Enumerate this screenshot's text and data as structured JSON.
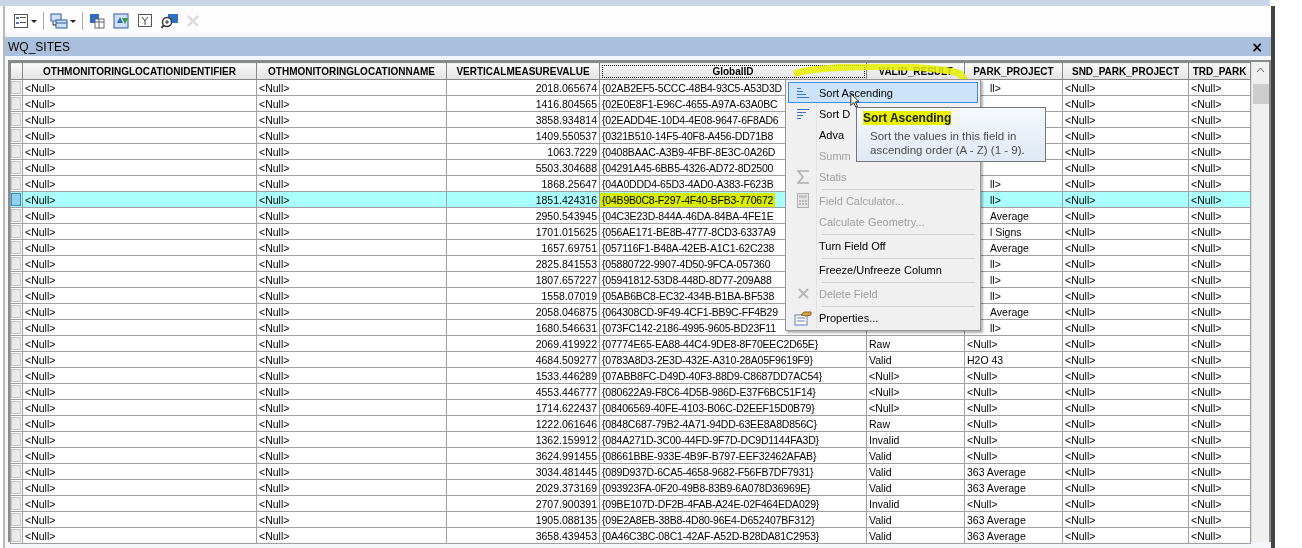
{
  "panel": {
    "title": "WQ_SITES",
    "close": "×"
  },
  "toolbar": [
    {
      "kind": "table-options",
      "dropdown": true,
      "disabled": false
    },
    {
      "kind": "related-tables",
      "dropdown": true,
      "disabled": false
    },
    {
      "kind": "select-attributes",
      "dropdown": false,
      "disabled": false
    },
    {
      "kind": "switch-selection",
      "dropdown": false,
      "disabled": false
    },
    {
      "kind": "clear-selection",
      "dropdown": false,
      "disabled": false
    },
    {
      "kind": "zoom-selected",
      "dropdown": false,
      "disabled": false
    },
    {
      "kind": "delete",
      "dropdown": false,
      "disabled": true
    }
  ],
  "table": {
    "columns": [
      {
        "label": "OTHMONITORINGLOCATIONIDENTIFIER",
        "selected": false
      },
      {
        "label": "OTHMONITORINGLOCATIONNAME",
        "selected": false
      },
      {
        "label": "VERTICALMEASUREVALUE",
        "selected": false
      },
      {
        "label": "GlobalID",
        "selected": true
      },
      {
        "label": "VALID_RESULT",
        "selected": false
      },
      {
        "label": "PARK_PROJECT",
        "selected": false
      },
      {
        "label": "SND_PARK_PROJECT",
        "selected": false
      },
      {
        "label": "TRD_PARK",
        "selected": false
      }
    ],
    "rows": [
      {
        "cells": [
          "<Null>",
          "<Null>",
          "2018.065674",
          "{02AB2EF5-5CCC-48B4-93C5-A53D3D",
          null,
          "ll>",
          "<Null>",
          "<Null>"
        ],
        "selected": false,
        "marked": false
      },
      {
        "cells": [
          "<Null>",
          "<Null>",
          "1416.804565",
          "{02E0E8F1-E96C-4655-A97A-63A0BC",
          null,
          null,
          "<Null>",
          "<Null>"
        ],
        "selected": false,
        "marked": false
      },
      {
        "cells": [
          "<Null>",
          "<Null>",
          "3858.934814",
          "{02EADD4E-10D4-4E08-9647-6F8AD6",
          null,
          null,
          "<Null>",
          "<Null>"
        ],
        "selected": false,
        "marked": false
      },
      {
        "cells": [
          "<Null>",
          "<Null>",
          "1409.550537",
          "{0321B510-14F5-40F8-A456-DD71B8",
          null,
          null,
          "<Null>",
          "<Null>"
        ],
        "selected": false,
        "marked": false
      },
      {
        "cells": [
          "<Null>",
          "<Null>",
          "1063.7229",
          "{0408BAAC-A3B9-4FBF-8E3C-0A26D",
          null,
          null,
          "<Null>",
          "<Null>"
        ],
        "selected": false,
        "marked": false
      },
      {
        "cells": [
          "<Null>",
          "<Null>",
          "5503.304688",
          "{04291A45-6BB5-4326-AD72-8D2500",
          null,
          null,
          "<Null>",
          "<Null>"
        ],
        "selected": false,
        "marked": false
      },
      {
        "cells": [
          "<Null>",
          "<Null>",
          "1868.25647",
          "{04A0DDD4-65D3-4AD0-A383-F623B",
          null,
          "ll>",
          "<Null>",
          "<Null>"
        ],
        "selected": false,
        "marked": false
      },
      {
        "cells": [
          "<Null>",
          "<Null>",
          "1851.424316",
          "{04B9B0C8-F297-4F40-BFB3-770672",
          null,
          "ll>",
          "<Null>",
          "<Null>"
        ],
        "selected": true,
        "marked": true
      },
      {
        "cells": [
          "<Null>",
          "<Null>",
          "2950.543945",
          "{04C3E23D-844A-46DA-84BA-4FE1E",
          null,
          "Average",
          "<Null>",
          "<Null>"
        ],
        "selected": false,
        "marked": false
      },
      {
        "cells": [
          "<Null>",
          "<Null>",
          "1701.015625",
          "{056AE171-BE8B-4777-8CD3-6337A9",
          null,
          "l Signs",
          "<Null>",
          "<Null>"
        ],
        "selected": false,
        "marked": false
      },
      {
        "cells": [
          "<Null>",
          "<Null>",
          "1657.69751",
          "{057116F1-B48A-42EB-A1C1-62C238",
          null,
          "Average",
          "<Null>",
          "<Null>"
        ],
        "selected": false,
        "marked": false
      },
      {
        "cells": [
          "<Null>",
          "<Null>",
          "2825.841553",
          "{05880722-9907-4D50-9FCA-057360",
          null,
          "ll>",
          "<Null>",
          "<Null>"
        ],
        "selected": false,
        "marked": false
      },
      {
        "cells": [
          "<Null>",
          "<Null>",
          "1807.657227",
          "{05941812-53D8-448D-8D77-209A88",
          null,
          "ll>",
          "<Null>",
          "<Null>"
        ],
        "selected": false,
        "marked": false
      },
      {
        "cells": [
          "<Null>",
          "<Null>",
          "1558.07019",
          "{05AB6BC8-EC32-434B-B1BA-BF538",
          null,
          "ll>",
          "<Null>",
          "<Null>"
        ],
        "selected": false,
        "marked": false
      },
      {
        "cells": [
          "<Null>",
          "<Null>",
          "2058.046875",
          "{064308CD-9F49-4CF1-BB9C-FF4B29",
          null,
          "Average",
          "<Null>",
          "<Null>"
        ],
        "selected": false,
        "marked": false
      },
      {
        "cells": [
          "<Null>",
          "<Null>",
          "1680.546631",
          "{073FC142-2186-4995-9605-BD23F11",
          null,
          "ll>",
          "<Null>",
          "<Null>"
        ],
        "selected": false,
        "marked": false
      },
      {
        "cells": [
          "<Null>",
          "<Null>",
          "2069.419922",
          "{07774E65-EA88-44C4-9DE8-8F70EEC2D65E}",
          "Raw",
          "<Null>",
          "<Null>",
          "<Null>"
        ],
        "selected": false,
        "marked": false
      },
      {
        "cells": [
          "<Null>",
          "<Null>",
          "4684.509277",
          "{0783A8D3-2E3D-432E-A310-28A05F9619F9}",
          "Valid",
          "H2O 43",
          "<Null>",
          "<Null>"
        ],
        "selected": false,
        "marked": false
      },
      {
        "cells": [
          "<Null>",
          "<Null>",
          "1533.446289",
          "{07ABB8FC-D49D-40F3-88D9-C8687DD7AC54}",
          "<Null>",
          "<Null>",
          "<Null>",
          "<Null>"
        ],
        "selected": false,
        "marked": false
      },
      {
        "cells": [
          "<Null>",
          "<Null>",
          "4553.446777",
          "{080622A9-F8C6-4D5B-986D-E37F6BC51F14}",
          "<Null>",
          "<Null>",
          "<Null>",
          "<Null>"
        ],
        "selected": false,
        "marked": false
      },
      {
        "cells": [
          "<Null>",
          "<Null>",
          "1714.622437",
          "{08406569-40FE-4103-B06C-D2EEF15D0B79}",
          "<Null>",
          "<Null>",
          "<Null>",
          "<Null>"
        ],
        "selected": false,
        "marked": false
      },
      {
        "cells": [
          "<Null>",
          "<Null>",
          "1222.061646",
          "{0848C687-79B2-4A71-94DD-63EE8A8D856C}",
          "Raw",
          "<Null>",
          "<Null>",
          "<Null>"
        ],
        "selected": false,
        "marked": false
      },
      {
        "cells": [
          "<Null>",
          "<Null>",
          "1362.159912",
          "{084A271D-3C00-44FD-9F7D-DC9D1144FA3D}",
          "Invalid",
          "<Null>",
          "<Null>",
          "<Null>"
        ],
        "selected": false,
        "marked": false
      },
      {
        "cells": [
          "<Null>",
          "<Null>",
          "3624.991455",
          "{08661BBE-933E-4B9F-B797-EEF32462AFAB}",
          "Valid",
          "<Null>",
          "<Null>",
          "<Null>"
        ],
        "selected": false,
        "marked": false
      },
      {
        "cells": [
          "<Null>",
          "<Null>",
          "3034.481445",
          "{089D937D-6CA5-4658-9682-F56FB7DF7931}",
          "Valid",
          "363 Average",
          "<Null>",
          "<Null>"
        ],
        "selected": false,
        "marked": false
      },
      {
        "cells": [
          "<Null>",
          "<Null>",
          "2029.373169",
          "{093923FA-0F20-49B8-83B9-6A078D36969E}",
          "Valid",
          "363 Average",
          "<Null>",
          "<Null>"
        ],
        "selected": false,
        "marked": false
      },
      {
        "cells": [
          "<Null>",
          "<Null>",
          "2707.900391",
          "{09BE107D-DF2B-4FAB-A24E-02F464EDA029}",
          "Invalid",
          "<Null>",
          "<Null>",
          "<Null>"
        ],
        "selected": false,
        "marked": false
      },
      {
        "cells": [
          "<Null>",
          "<Null>",
          "1905.088135",
          "{09E2A8EB-38B8-4D80-96E4-D652407BF312}",
          "Valid",
          "363 Average",
          "<Null>",
          "<Null>"
        ],
        "selected": false,
        "marked": false
      },
      {
        "cells": [
          "<Null>",
          "<Null>",
          "3658.439453",
          "{0A46C38C-08C1-42AF-A52D-B28DA81C2953}",
          "Valid",
          "363 Average",
          "<Null>",
          "<Null>"
        ],
        "selected": false,
        "marked": false
      }
    ]
  },
  "context_menu": {
    "items": [
      {
        "label": "Sort Ascending",
        "kind": "sort-asc",
        "disabled": false,
        "hovered": true,
        "separator_before": false
      },
      {
        "label": "Sort D",
        "kind": "sort-desc",
        "disabled": false,
        "hovered": false,
        "separator_before": false
      },
      {
        "label": "Adva",
        "kind": "plain",
        "disabled": false,
        "hovered": false,
        "separator_before": false
      },
      {
        "label": "Summ",
        "kind": "plain",
        "disabled": true,
        "hovered": false,
        "separator_before": false
      },
      {
        "label": "Statis",
        "kind": "sigma",
        "disabled": true,
        "hovered": false,
        "separator_before": false
      },
      {
        "label": "Field Calculator...",
        "kind": "calculator",
        "disabled": true,
        "hovered": false,
        "separator_before": true
      },
      {
        "label": "Calculate Geometry...",
        "kind": "plain",
        "disabled": true,
        "hovered": false,
        "separator_before": false
      },
      {
        "label": "Turn Field Off",
        "kind": "plain",
        "disabled": false,
        "hovered": false,
        "separator_before": true
      },
      {
        "label": "Freeze/Unfreeze Column",
        "kind": "plain",
        "disabled": false,
        "hovered": false,
        "separator_before": true
      },
      {
        "label": "Delete Field",
        "kind": "delete",
        "disabled": true,
        "hovered": false,
        "separator_before": true
      },
      {
        "label": "Properties...",
        "kind": "properties",
        "disabled": false,
        "hovered": false,
        "separator_before": true
      }
    ]
  },
  "tooltip": {
    "title": "Sort Ascending",
    "title_marked": true,
    "body": "Sort the values in this field in ascending order (A - Z) (1 - 9)."
  }
}
